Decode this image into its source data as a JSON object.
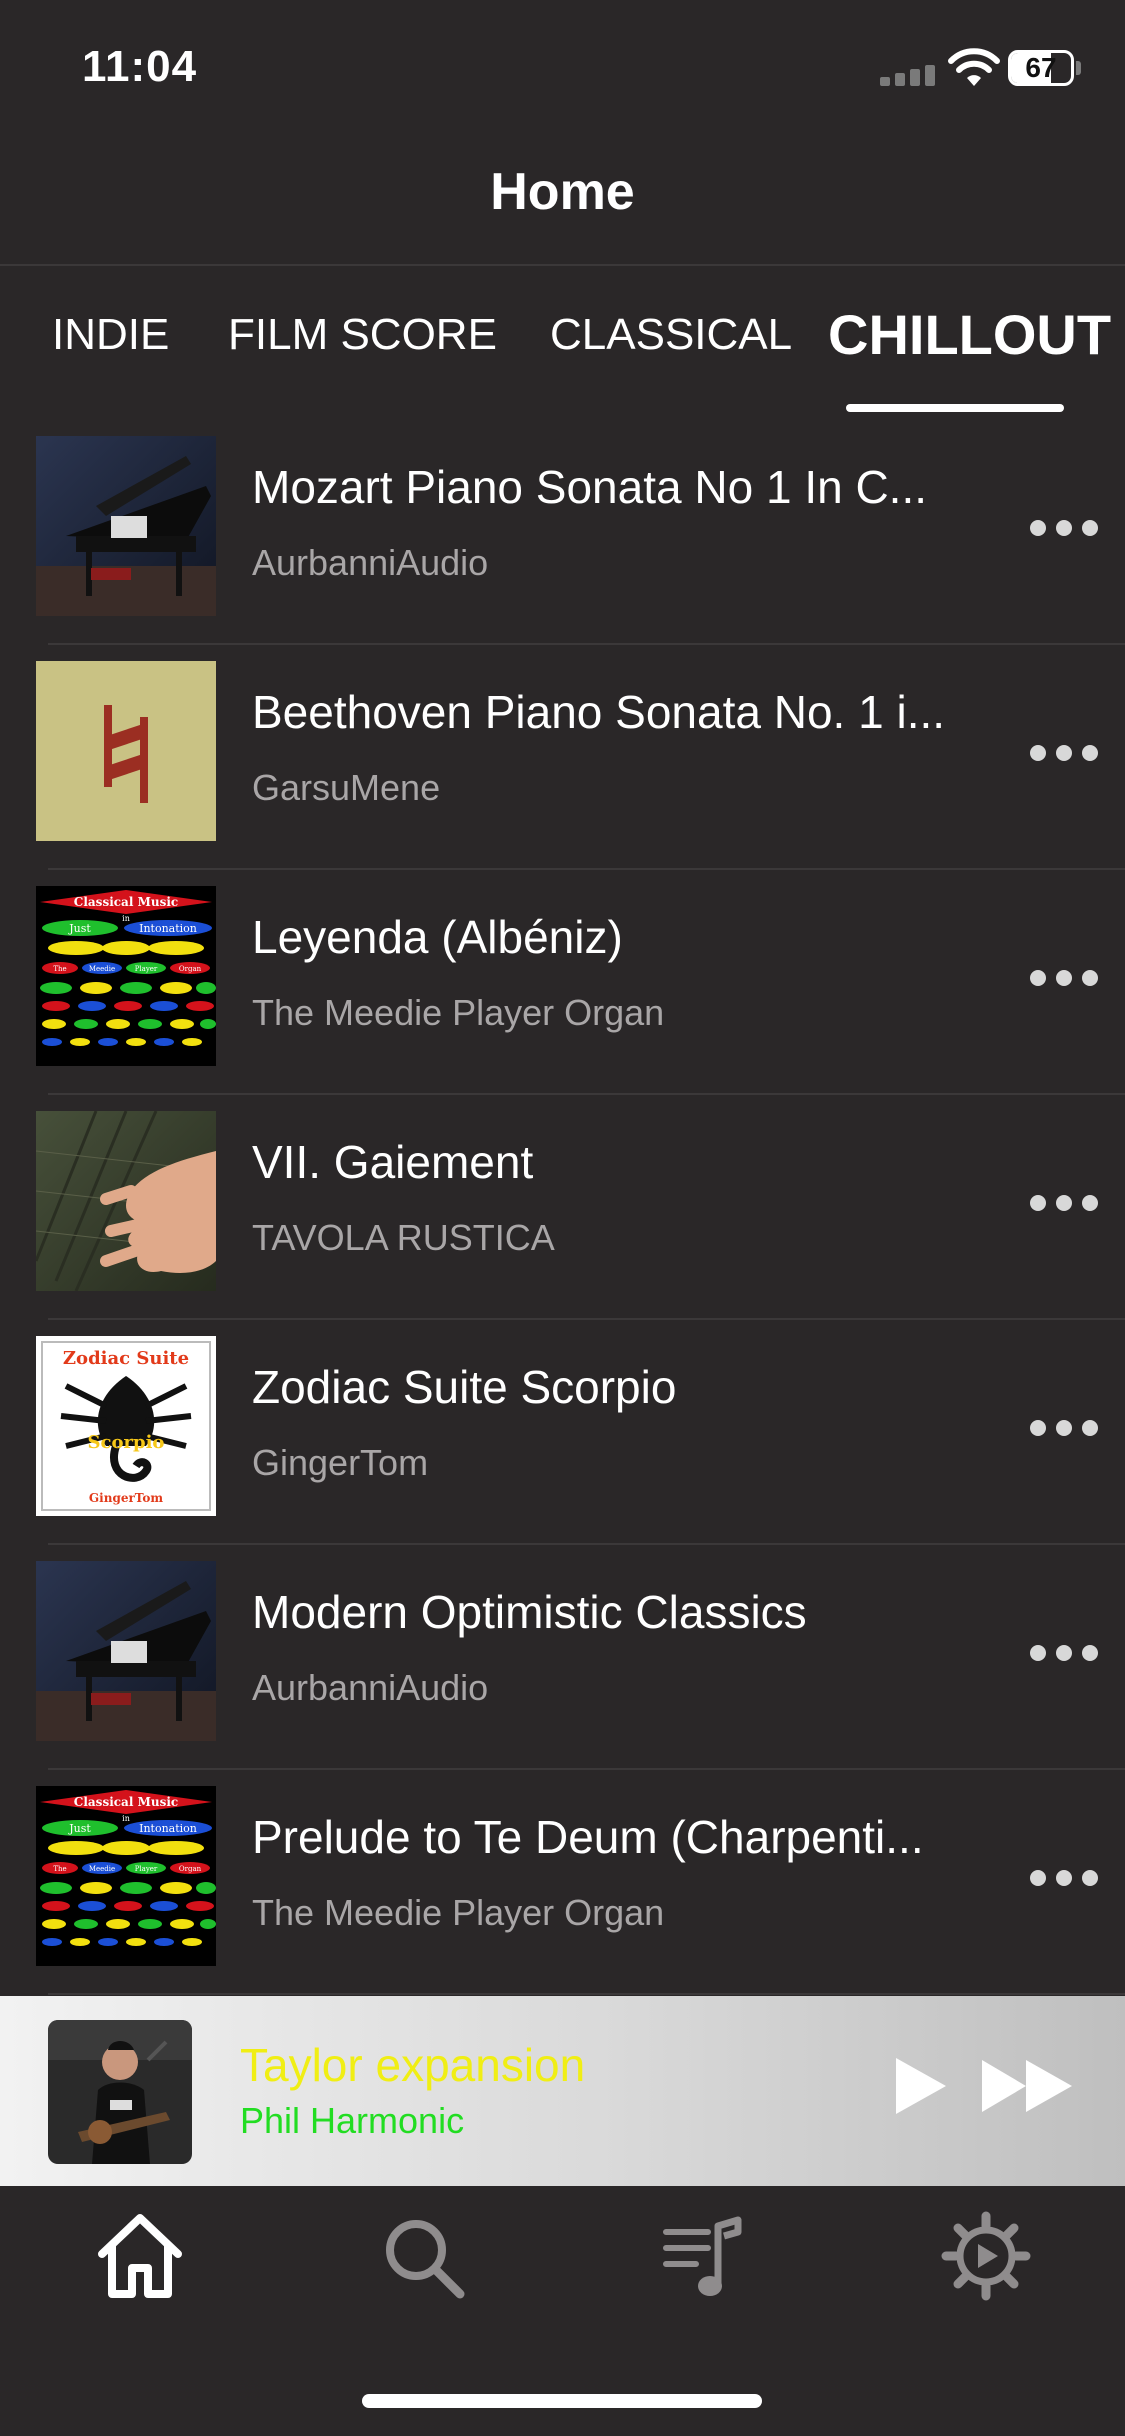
{
  "status": {
    "time": "11:04",
    "battery": "67"
  },
  "nav": {
    "title": "Home"
  },
  "tabs": [
    {
      "label": "INDIE",
      "active": false
    },
    {
      "label": "FILM SCORE",
      "active": false
    },
    {
      "label": "CLASSICAL",
      "active": false
    },
    {
      "label": "CHILLOUT",
      "active": true
    }
  ],
  "tracks": [
    {
      "title": "Mozart Piano Sonata No 1 In C...",
      "artist": "AurbanniAudio",
      "art": "grand-piano"
    },
    {
      "title": "Beethoven Piano Sonata No. 1 i...",
      "artist": "GarsuMene",
      "art": "natural-sign"
    },
    {
      "title": "Leyenda (Albéniz)",
      "artist": "The Meedie Player Organ",
      "art": "just-intonation"
    },
    {
      "title": "VII. Gaiement",
      "artist": "TAVOLA RUSTICA",
      "art": "hand-strings"
    },
    {
      "title": "Zodiac Suite Scorpio",
      "artist": "GingerTom",
      "art": "scorpio"
    },
    {
      "title": "Modern Optimistic Classics",
      "artist": "AurbanniAudio",
      "art": "grand-piano"
    },
    {
      "title": "Prelude to Te Deum (Charpenti...",
      "artist": "The Meedie Player Organ",
      "art": "just-intonation"
    }
  ],
  "art_text": {
    "classical_music": "Classical Music",
    "just": "Just",
    "in": "in",
    "intonation": "Intonation",
    "the": "The",
    "meedie": "Meedie",
    "player": "Player",
    "organ": "Organ",
    "zodiac_suite": "Zodiac Suite",
    "scorpio": "Scorpio",
    "gingertom": "GingerTom"
  },
  "now_playing": {
    "title": "Taylor expansion",
    "artist": "Phil Harmonic"
  },
  "colors": {
    "background": "#2a2728",
    "now_playing_title": "#f0ee14",
    "now_playing_artist": "#22dd22",
    "secondary_text": "#a9a6a7"
  },
  "tab_bar": [
    {
      "icon": "home-icon",
      "active": true
    },
    {
      "icon": "search-icon",
      "active": false
    },
    {
      "icon": "playlist-icon",
      "active": false
    },
    {
      "icon": "settings-icon",
      "active": false
    }
  ]
}
